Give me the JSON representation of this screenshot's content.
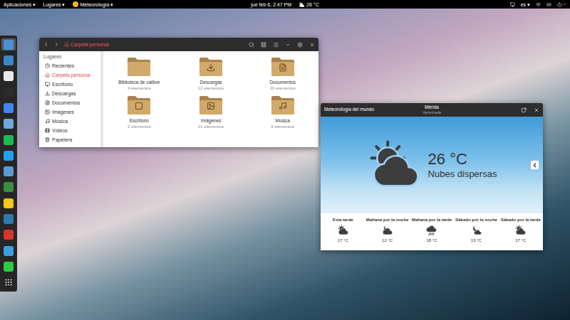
{
  "top_bar": {
    "menus": [
      "Aplicaciones ▾",
      "Lugares ▾"
    ],
    "app_menu": "Meteorología ▾",
    "clock": "jue feb 6, 2:47 PM",
    "weather": "26 °C",
    "language": "es ▾"
  },
  "dock": {
    "items": [
      {
        "color": "#4a90d9",
        "selected": true
      },
      {
        "color": "#3d85c6",
        "selected": false
      },
      {
        "color": "#e8e8e8",
        "selected": false
      },
      {
        "color": "#2b2b2b",
        "selected": false
      },
      {
        "color": "#4285f4",
        "selected": false
      },
      {
        "color": "#6fa8dc",
        "selected": false
      },
      {
        "color": "#1db954",
        "selected": false
      },
      {
        "color": "#1da1f2",
        "selected": false
      },
      {
        "color": "#5b9bd5",
        "selected": false
      },
      {
        "color": "#3c8d3c",
        "selected": false
      },
      {
        "color": "#f5c518",
        "selected": false
      },
      {
        "color": "#2a7ab0",
        "selected": false
      },
      {
        "color": "#d9342b",
        "selected": false
      },
      {
        "color": "#3aa0e0",
        "selected": false
      },
      {
        "color": "#2ecc40",
        "selected": false
      }
    ]
  },
  "file_manager": {
    "title": "Carpeta personal",
    "sidebar": {
      "heading": "Lugares",
      "items": [
        {
          "label": "Recientes",
          "kind": "recent",
          "selected": false
        },
        {
          "label": "Carpeta personal",
          "kind": "home",
          "selected": true
        },
        {
          "label": "Escritorio",
          "kind": "desktop",
          "selected": false
        },
        {
          "label": "Descargas",
          "kind": "downloads",
          "selected": false
        },
        {
          "label": "Documentos",
          "kind": "documents",
          "selected": false
        },
        {
          "label": "Imágenes",
          "kind": "pictures",
          "selected": false
        },
        {
          "label": "Música",
          "kind": "music",
          "selected": false
        },
        {
          "label": "Vídeos",
          "kind": "videos",
          "selected": false
        },
        {
          "label": "Papelera",
          "kind": "trash",
          "selected": false
        }
      ]
    },
    "folders": [
      {
        "name": "Biblioteca de calibre",
        "count": "4 elementos",
        "kind": "plain"
      },
      {
        "name": "Descargas",
        "count": "12 elementos",
        "kind": "downloads"
      },
      {
        "name": "Documentos",
        "count": "10 elementos",
        "kind": "documents"
      },
      {
        "name": "Escritorio",
        "count": "2 elementos",
        "kind": "desktop"
      },
      {
        "name": "Imágenes",
        "count": "21 elementos",
        "kind": "pictures"
      },
      {
        "name": "Música",
        "count": "9 elementos",
        "kind": "music"
      }
    ]
  },
  "weather": {
    "header": {
      "app": "Meteorología del mundo",
      "city": "Mérida",
      "country": "Venezuela"
    },
    "current": {
      "temp": "26 °C",
      "summary": "Nubes dispersas",
      "kind": "partly-cloudy"
    },
    "forecast": [
      {
        "label": "Esta tarde",
        "temp": "17 °C",
        "kind": "partly-cloudy"
      },
      {
        "label": "Mañana por la noche",
        "temp": "12 °C",
        "kind": "cloudy-night"
      },
      {
        "label": "Mañana por la tarde",
        "temp": "18 °C",
        "kind": "rain"
      },
      {
        "label": "Sábado por la noche",
        "temp": "13 °C",
        "kind": "clear-night"
      },
      {
        "label": "Sábado por la tarde",
        "temp": "17 °C",
        "kind": "partly-cloudy"
      }
    ]
  }
}
